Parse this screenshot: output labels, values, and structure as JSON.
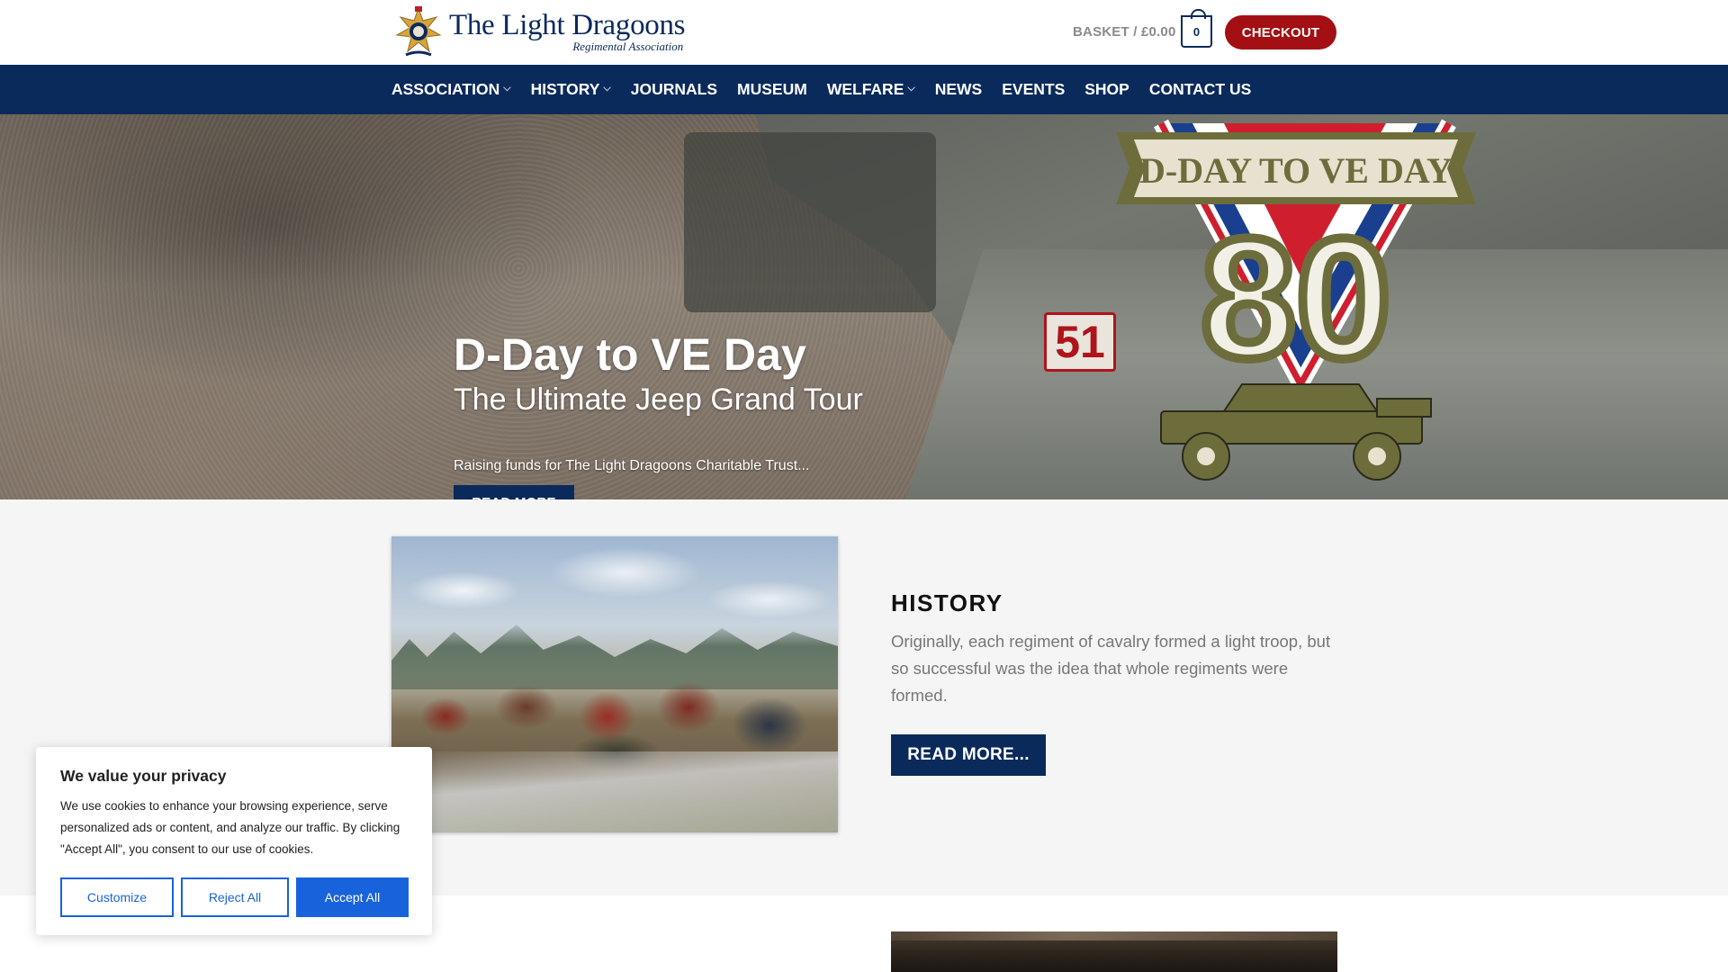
{
  "header": {
    "logo_title": "The Light Dragoons",
    "logo_subtitle": "Regimental Association",
    "basket_label": "BASKET / £0.00",
    "basket_count": "0",
    "checkout_label": "CHECKOUT",
    "accent_color": "#0b2a5c",
    "checkout_color": "#a30f12"
  },
  "nav": {
    "items": [
      {
        "label": "ASSOCIATION",
        "has_dropdown": true
      },
      {
        "label": "HISTORY",
        "has_dropdown": true
      },
      {
        "label": "JOURNALS",
        "has_dropdown": false
      },
      {
        "label": "MUSEUM",
        "has_dropdown": false
      },
      {
        "label": "WELFARE",
        "has_dropdown": true
      },
      {
        "label": "NEWS",
        "has_dropdown": false
      },
      {
        "label": "EVENTS",
        "has_dropdown": false
      },
      {
        "label": "SHOP",
        "has_dropdown": false
      },
      {
        "label": "CONTACT US",
        "has_dropdown": false
      }
    ],
    "dropdown_icon": "chevron-down-icon"
  },
  "hero": {
    "title": "D-Day to VE Day",
    "subtitle": "The Ultimate Jeep Grand Tour",
    "description": "Raising funds for The Light Dragoons Charitable Trust...",
    "button_label": "READ MORE",
    "emblem_top_text": "D-DAY TO VE DAY",
    "emblem_number": "80",
    "vehicle_number": "51",
    "slides_total": 3,
    "active_slide": 1
  },
  "history": {
    "title": "HISTORY",
    "body": "Originally, each regiment of cavalry formed a light troop, but so successful was the idea that whole regiments were formed.",
    "button_label": "READ MORE..."
  },
  "cookie": {
    "title": "We value your privacy",
    "text": "We use cookies to enhance your browsing experience, serve personalized ads or content, and analyze our traffic. By clicking \"Accept All\", you consent to our use of cookies.",
    "customize_label": "Customize",
    "reject_label": "Reject All",
    "accept_label": "Accept All",
    "accent_color": "#1863dc"
  }
}
